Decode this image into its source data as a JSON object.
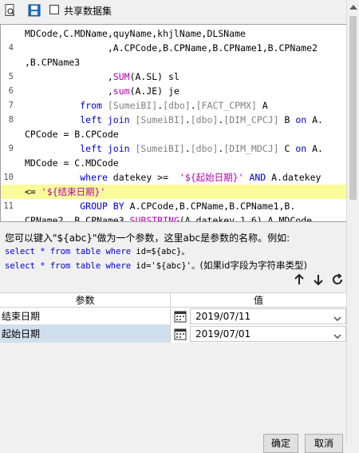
{
  "toolbar": {
    "share_dataset_label": "共享数据集"
  },
  "editor": {
    "lines": [
      {
        "num": "",
        "segments": [
          {
            "t": "MDCode,C.MDName,quyName,khjlName,DLSName",
            "c": "cm"
          }
        ]
      },
      {
        "num": "4",
        "segments": [
          {
            "t": "               ,A.CPCode,B.CPName,B.CPName1,B.CPName2",
            "c": "cm"
          }
        ]
      },
      {
        "num": "",
        "segments": [
          {
            "t": ",B.CPName3",
            "c": "cm"
          }
        ]
      },
      {
        "num": "5",
        "segments": [
          {
            "t": "               ,",
            "c": "cm"
          },
          {
            "t": "SUM",
            "c": "fn"
          },
          {
            "t": "(A.SL) sl",
            "c": "cm"
          }
        ]
      },
      {
        "num": "6",
        "segments": [
          {
            "t": "               ,",
            "c": "cm"
          },
          {
            "t": "sum",
            "c": "fn"
          },
          {
            "t": "(A.JE) je",
            "c": "cm"
          }
        ]
      },
      {
        "num": "7",
        "segments": [
          {
            "t": "          ",
            "c": "cm"
          },
          {
            "t": "from",
            "c": "kw"
          },
          {
            "t": " ",
            "c": "cm"
          },
          {
            "t": "[SumeiBI]",
            "c": "gray"
          },
          {
            "t": ".",
            "c": "cm"
          },
          {
            "t": "[dbo]",
            "c": "gray"
          },
          {
            "t": ".",
            "c": "cm"
          },
          {
            "t": "[FACT_CPMX]",
            "c": "gray"
          },
          {
            "t": " A",
            "c": "cm"
          }
        ]
      },
      {
        "num": "8",
        "segments": [
          {
            "t": "          ",
            "c": "cm"
          },
          {
            "t": "left join",
            "c": "kw"
          },
          {
            "t": " ",
            "c": "cm"
          },
          {
            "t": "[SumeiBI]",
            "c": "gray"
          },
          {
            "t": ".",
            "c": "cm"
          },
          {
            "t": "[dbo]",
            "c": "gray"
          },
          {
            "t": ".",
            "c": "cm"
          },
          {
            "t": "[DIM_CPCJ]",
            "c": "gray"
          },
          {
            "t": " B ",
            "c": "cm"
          },
          {
            "t": "on",
            "c": "kw"
          },
          {
            "t": " A.",
            "c": "cm"
          }
        ]
      },
      {
        "num": "",
        "segments": [
          {
            "t": "CPCode = B.CPCode",
            "c": "cm"
          }
        ]
      },
      {
        "num": "9",
        "segments": [
          {
            "t": "          ",
            "c": "cm"
          },
          {
            "t": "left join",
            "c": "kw"
          },
          {
            "t": " ",
            "c": "cm"
          },
          {
            "t": "[SumeiBI]",
            "c": "gray"
          },
          {
            "t": ".",
            "c": "cm"
          },
          {
            "t": "[dbo]",
            "c": "gray"
          },
          {
            "t": ".",
            "c": "cm"
          },
          {
            "t": "[DIM_MDCJ]",
            "c": "gray"
          },
          {
            "t": " C ",
            "c": "cm"
          },
          {
            "t": "on",
            "c": "kw"
          },
          {
            "t": " A.",
            "c": "cm"
          }
        ]
      },
      {
        "num": "",
        "segments": [
          {
            "t": "MDCode = C.MDCode",
            "c": "cm"
          }
        ]
      },
      {
        "num": "10",
        "segments": [
          {
            "t": "          ",
            "c": "cm"
          },
          {
            "t": "where",
            "c": "kw"
          },
          {
            "t": " datekey >=  ",
            "c": "cm"
          },
          {
            "t": "'${起始日期}'",
            "c": "str"
          },
          {
            "t": " ",
            "c": "cm"
          },
          {
            "t": "AND",
            "c": "kw"
          },
          {
            "t": " A.datekey",
            "c": "cm"
          }
        ]
      },
      {
        "num": "",
        "hl": true,
        "segments": [
          {
            "t": "<= ",
            "c": "cm"
          },
          {
            "t": "'${结束日期}'",
            "c": "str"
          }
        ]
      },
      {
        "num": "11",
        "segments": [
          {
            "t": "          ",
            "c": "cm"
          },
          {
            "t": "GROUP BY",
            "c": "kw"
          },
          {
            "t": " A.CPCode,B.CPName,B.CPName1,B.",
            "c": "cm"
          }
        ]
      },
      {
        "num": "",
        "segments": [
          {
            "t": "CPName2 ,B.CPName3,",
            "c": "cm"
          },
          {
            "t": "SUBSTRING",
            "c": "fn"
          },
          {
            "t": "(A.datekey,1,6),A.MDCode,",
            "c": "cm"
          }
        ]
      },
      {
        "num": "",
        "segments": [
          {
            "t": "quyName,khjlName,DLSName,C.MDName",
            "c": "cm"
          }
        ]
      },
      {
        "num": "12",
        "segments": [
          {
            "t": "",
            "c": "cm"
          }
        ]
      }
    ]
  },
  "help": {
    "line1": "您可以键入\"${abc}\"做为一个参数，这里abc是参数的名称。例如:",
    "line2": "select * from table where id=${abc}。",
    "line3_code": "select * from table where id='${abc}'。",
    "line3_note": "(如果id字段为字符串类型)"
  },
  "params": {
    "col_name": "参数",
    "col_value": "值",
    "rows": [
      {
        "name": "结束日期",
        "value": "2019/07/11"
      },
      {
        "name": "起始日期",
        "value": "2019/07/01"
      }
    ]
  },
  "buttons": {
    "ok": "确定",
    "cancel": "取消"
  }
}
